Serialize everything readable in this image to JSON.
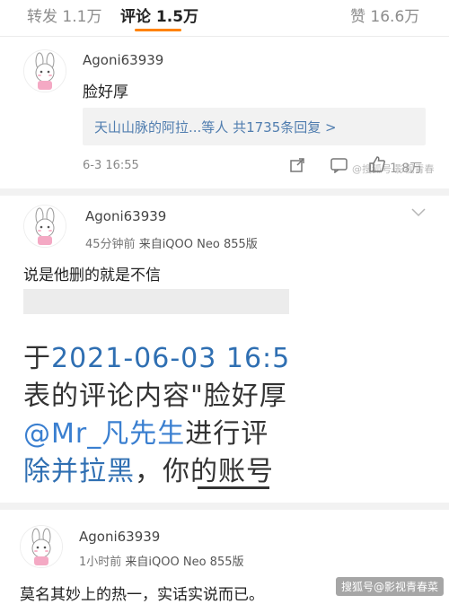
{
  "tabs": [
    {
      "label": "转发",
      "count": "1.1万"
    },
    {
      "label": "评论",
      "count": "1.5万",
      "active": true
    },
    {
      "label": "赞",
      "count": "16.6万"
    }
  ],
  "comment1": {
    "username": "Agoni63939",
    "text": "脸好厚",
    "replies_prefix": "天山山脉的阿拉...等人",
    "replies_count": "共1735条回复 >",
    "time": "6-3 16:55",
    "likes": "1.8万",
    "watermark": "@搜狐号·影视青春"
  },
  "comment2": {
    "username": "Agoni63939",
    "time_ago": "45分钟前",
    "source": "来自iQOO Neo 855版",
    "text": "说是他删的就是不信",
    "notice": {
      "line1_prefix": "于",
      "line1_date": "2021-06-03 16:5",
      "line2": "表的评论内容\"脸好厚",
      "line3_mention": "@Mr_凡先生",
      "line3_rest": "进行评",
      "line4_prefix": "除并拉黑",
      "line4_rest": "，你的账号"
    }
  },
  "comment3": {
    "username": "Agoni63939",
    "time_ago": "1小时前",
    "source": "来自iQOO Neo 855版",
    "text": "莫名其妙上的热一，实话实说而已。"
  },
  "footer_watermark": "搜狐号@影视青春菜",
  "colors": {
    "accent": "#ff8200",
    "link": "#507daf"
  }
}
